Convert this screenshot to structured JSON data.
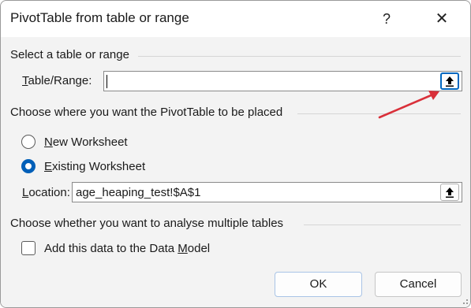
{
  "dialog": {
    "title": "PivotTable from table or range",
    "help_label": "?",
    "close_label": "✕"
  },
  "select_section": {
    "heading": "Select a table or range",
    "range_label_accel": "T",
    "range_label_rest": "able/Range:",
    "range_value": ""
  },
  "placement_section": {
    "heading": "Choose where you want the PivotTable to be placed",
    "new_worksheet_accel": "N",
    "new_worksheet_rest": "ew Worksheet",
    "new_worksheet_selected": false,
    "existing_worksheet_accel": "E",
    "existing_worksheet_rest": "xisting Worksheet",
    "existing_worksheet_selected": true,
    "location_label_accel": "L",
    "location_label_rest": "ocation:",
    "location_value": "age_heaping_test!$A$1"
  },
  "multiple_tables_section": {
    "heading": "Choose whether you want to analyse multiple tables",
    "data_model_label_before": "Add this data to the Data ",
    "data_model_label_accel": "M",
    "data_model_label_after": "odel",
    "data_model_checked": false
  },
  "footer": {
    "ok_label": "OK",
    "cancel_label": "Cancel"
  },
  "icons": {
    "range_picker": "collapse-dialog-arrow-up-icon",
    "annotation": "red-arrow-icon",
    "resize": "resize-grip-icon"
  },
  "colors": {
    "accent": "#005fb8",
    "annotation_arrow": "#d9303a",
    "body_background": "#f3f3f3"
  }
}
